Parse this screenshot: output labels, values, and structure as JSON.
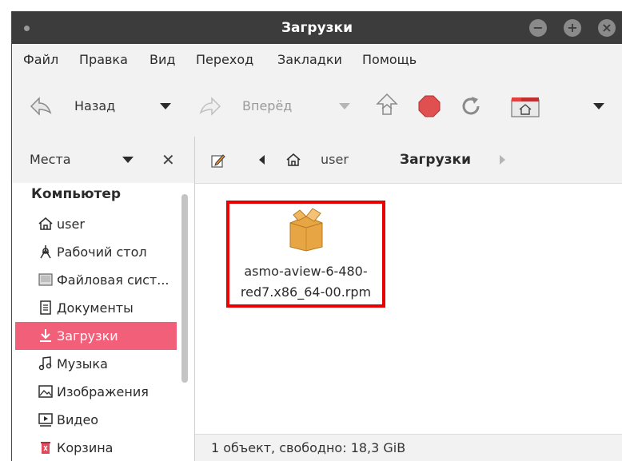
{
  "window": {
    "title": "Загрузки"
  },
  "menubar": {
    "items": [
      "Файл",
      "Правка",
      "Вид",
      "Переход",
      "Закладки",
      "Помощь"
    ]
  },
  "toolbar": {
    "back_label": "Назад",
    "forward_label": "Вперёд"
  },
  "sidebar": {
    "places_label": "Места",
    "section_title": "Компьютер",
    "items": [
      {
        "label": "user",
        "icon": "home-icon"
      },
      {
        "label": "Рабочий стол",
        "icon": "desktop-icon"
      },
      {
        "label": "Файловая сист...",
        "icon": "drive-icon"
      },
      {
        "label": "Документы",
        "icon": "document-icon"
      },
      {
        "label": "Загрузки",
        "icon": "download-icon",
        "active": true
      },
      {
        "label": "Музыка",
        "icon": "music-icon"
      },
      {
        "label": "Изображения",
        "icon": "image-icon"
      },
      {
        "label": "Видео",
        "icon": "video-icon"
      },
      {
        "label": "Корзина",
        "icon": "trash-icon"
      }
    ]
  },
  "pathbar": {
    "crumbs": [
      "user",
      "Загрузки"
    ]
  },
  "files": [
    {
      "name_line1": "asmo-aview-6-480-",
      "name_line2": "red7.x86_64-00.rpm",
      "icon": "package-icon"
    }
  ],
  "status": {
    "text": "1 объект, свободно: 18,3 GiB"
  },
  "colors": {
    "accent": "#f15f79",
    "highlight_border": "#e80000",
    "titlebar": "#3c3c3c"
  }
}
